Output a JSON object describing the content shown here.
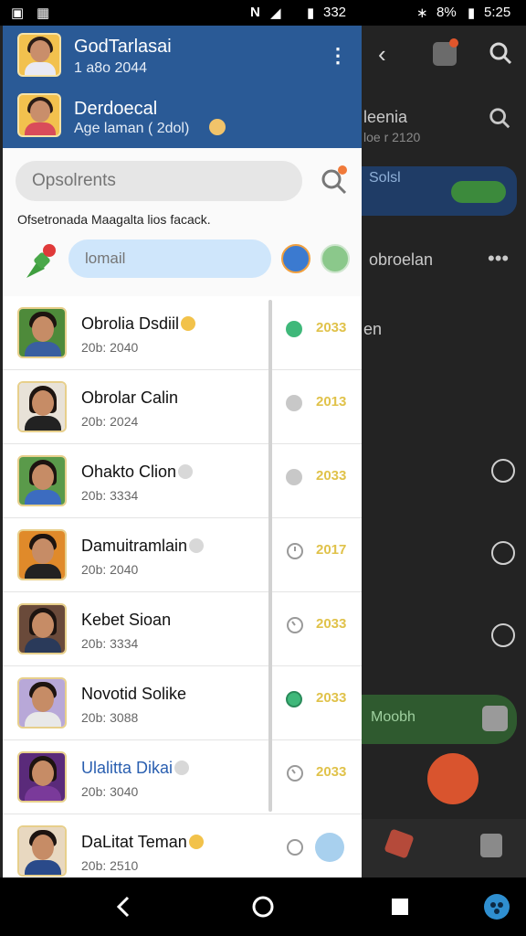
{
  "status_bar": {
    "left_time": "332",
    "right_battery": "8%",
    "right_time": "5:25"
  },
  "background": {
    "item1_title": "leenia",
    "item1_sub": "loe r 2120",
    "item2_title": "Solsl",
    "item3_title": "obroelan",
    "item4_title": "en",
    "item5_title": "Moobh"
  },
  "drawer": {
    "account1": {
      "name": "GodTarlasai",
      "sub": "1 a8o 2044"
    },
    "account2": {
      "name": "Derdoecal",
      "sub": "Age laman ( 2dol)"
    },
    "search": {
      "placeholder": "Opsolrents"
    },
    "notice": "Ofsetronada Maagalta lios facack.",
    "email": {
      "placeholder": "lomail"
    },
    "chats": [
      {
        "name": "Obrolia Dsdiil",
        "sub": "20b: 2040",
        "count": "2033",
        "status": "online",
        "name_style": "normal"
      },
      {
        "name": "Obrolar Calin",
        "sub": "20b: 2024",
        "count": "2013",
        "status": "idle",
        "name_style": "normal"
      },
      {
        "name": "Ohakto Clion",
        "sub": "20b: 3334",
        "count": "2033",
        "status": "idle",
        "name_style": "normal"
      },
      {
        "name": "Damuitramlain",
        "sub": "20b: 2040",
        "count": "2017",
        "status": "clock",
        "name_style": "normal"
      },
      {
        "name": "Kebet Sioan",
        "sub": "20b: 3334",
        "count": "2033",
        "status": "clock",
        "name_style": "normal"
      },
      {
        "name": "Novotid Solike",
        "sub": "20b: 3088",
        "count": "2033",
        "status": "badge",
        "name_style": "normal"
      },
      {
        "name": "Ulalitta Dikai",
        "sub": "20b: 3040",
        "count": "2033",
        "status": "clock",
        "name_style": "blue"
      },
      {
        "name": "DaLitat Teman",
        "sub": "20b: 2510",
        "count": "",
        "status": "clock",
        "name_style": "normal"
      }
    ]
  },
  "colors": {
    "drawer_header": "#2a5a96",
    "online": "#3fb87a",
    "idle": "#c8c8c8",
    "count": "#e0c24a"
  }
}
